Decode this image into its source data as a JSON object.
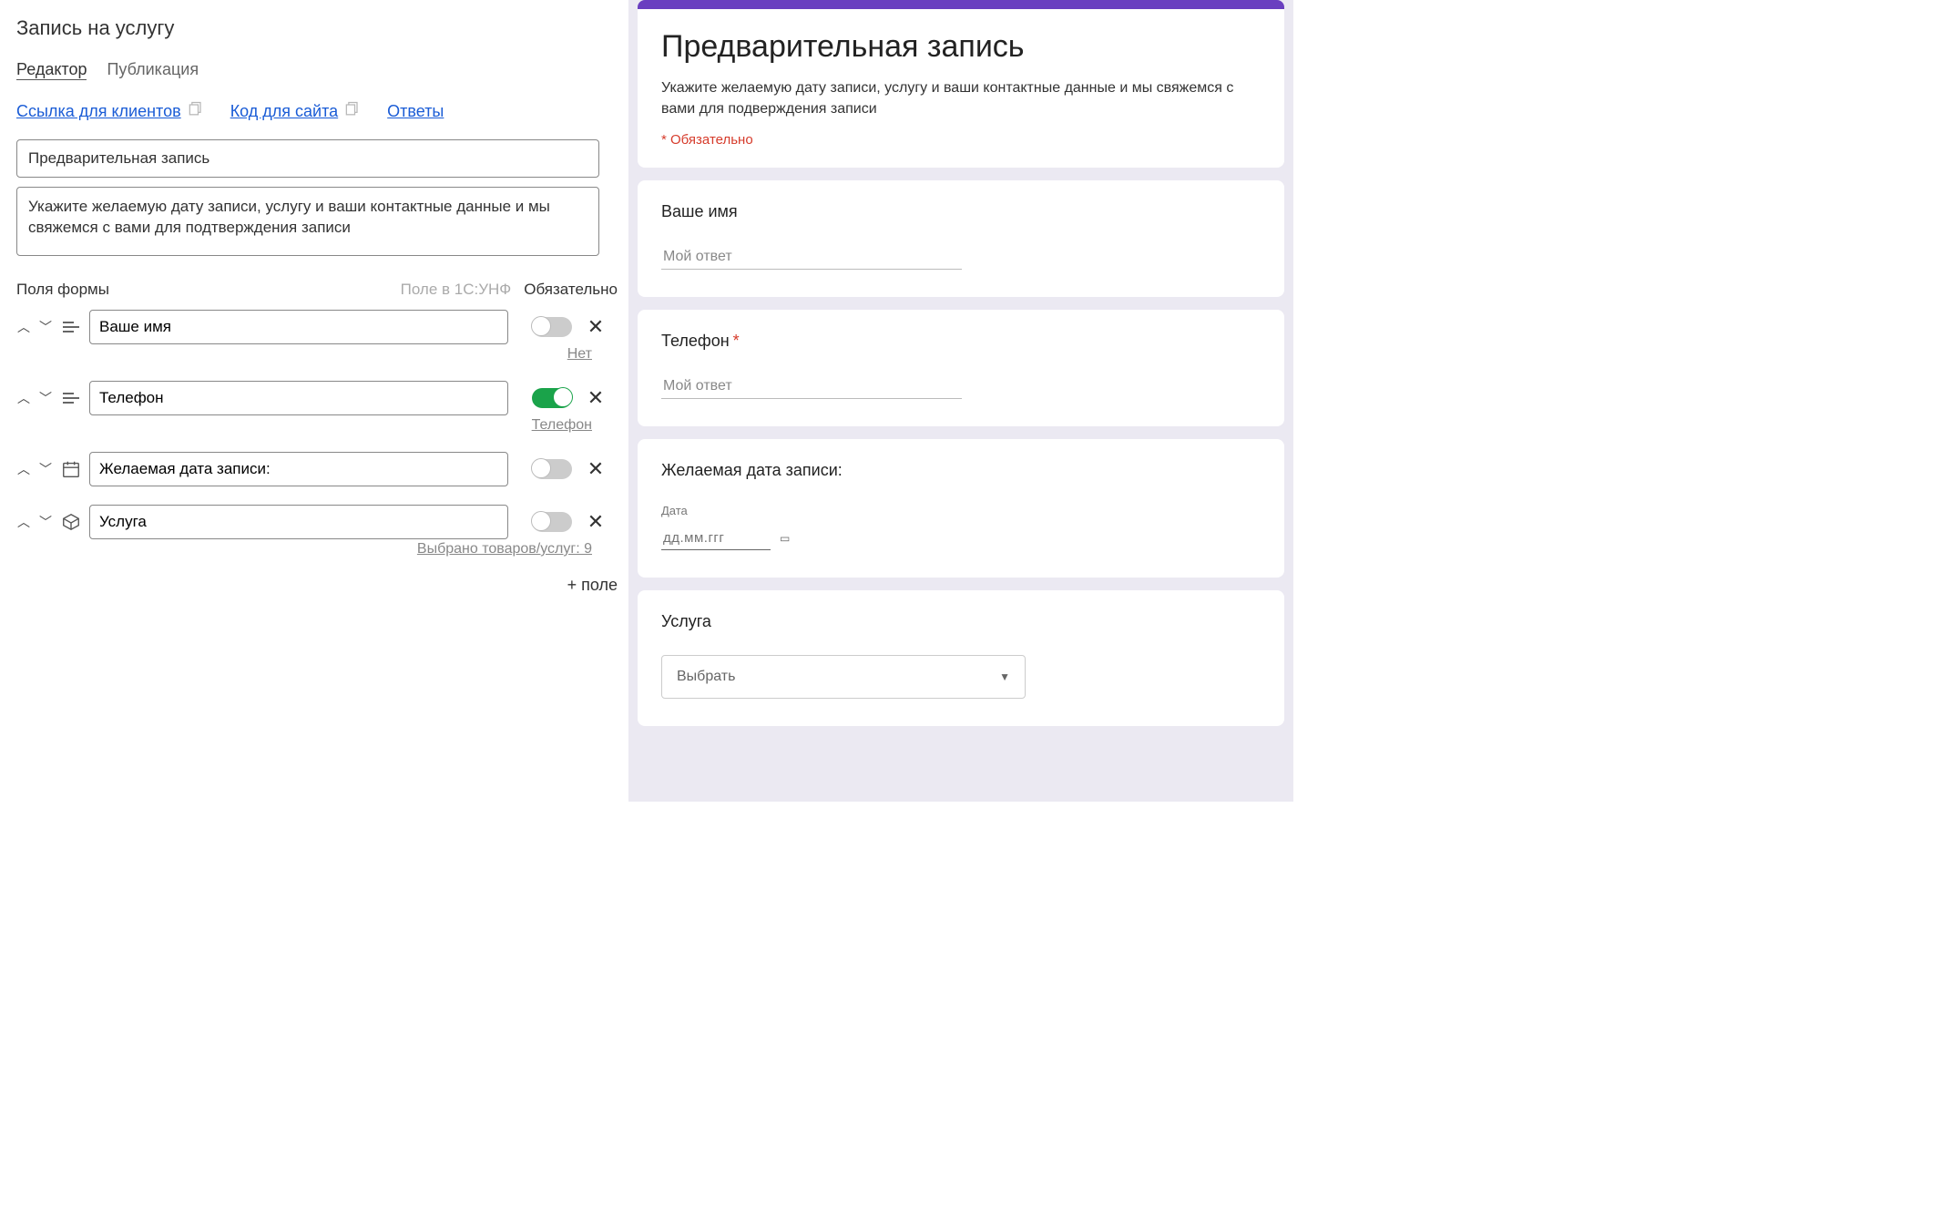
{
  "left": {
    "title": "Запись на услугу",
    "tabs": {
      "editor": "Редактор",
      "publish": "Публикация"
    },
    "links": {
      "client_link": "Ссылка для клиентов",
      "site_code": "Код для сайта",
      "responses": "Ответы"
    },
    "form_title_value": "Предварительная запись",
    "form_desc_value": "Укажите желаемую дату записи, услугу и ваши контактные данные и мы свяжемся с вами для подтверждения записи",
    "columns": {
      "fields": "Поля формы",
      "map": "Поле в 1С:УНФ",
      "required": "Обязательно"
    },
    "fields": [
      {
        "label": "Ваше имя",
        "type": "text",
        "required": false,
        "mapping": "Нет"
      },
      {
        "label": "Телефон",
        "type": "text",
        "required": true,
        "mapping": "Телефон"
      },
      {
        "label": "Желаемая дата записи:",
        "type": "date",
        "required": false,
        "mapping": ""
      },
      {
        "label": "Услуга",
        "type": "product",
        "required": false,
        "mapping": "Выбрано товаров/услуг: 9"
      }
    ],
    "add_field": "+ поле"
  },
  "right": {
    "title": "Предварительная запись",
    "desc": "Укажите желаемую дату записи, услугу и ваши контактные данные и мы свяжемся с вами для подверждения записи",
    "required_note": "* Обязательно",
    "blocks": {
      "name": {
        "label": "Ваше имя",
        "placeholder": "Мой ответ"
      },
      "phone": {
        "label": "Телефон",
        "placeholder": "Мой ответ",
        "required": true
      },
      "date": {
        "label": "Желаемая дата записи:",
        "sublabel": "Дата",
        "placeholder": "дд.мм.ггг"
      },
      "service": {
        "label": "Услуга",
        "select_placeholder": "Выбрать"
      }
    }
  }
}
